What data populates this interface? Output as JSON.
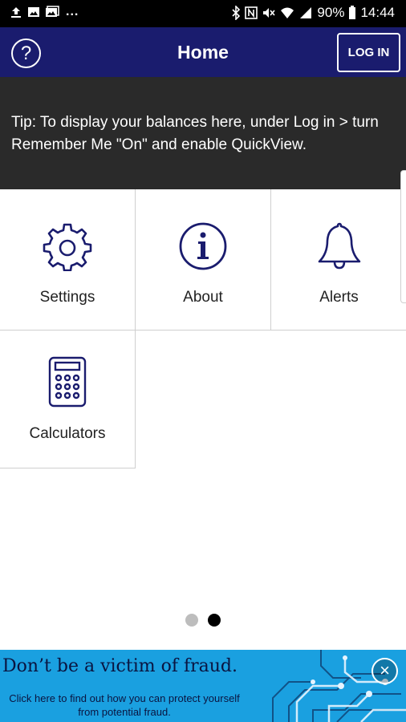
{
  "status_bar": {
    "battery_percent": "90%",
    "time": "14:44",
    "overflow": "...",
    "left_icons": [
      "upload-icon",
      "image-icon",
      "gallery-icon"
    ],
    "right_icons": [
      "bluetooth-icon",
      "nfc-icon",
      "mute-icon",
      "wifi-icon",
      "signal-icon",
      "battery-icon"
    ]
  },
  "app_bar": {
    "title": "Home",
    "help_symbol": "?",
    "login_label": "LOG IN",
    "background": "#1a1c6e"
  },
  "tip": {
    "text": "Tip: To display your balances here, under Log in > turn Remember Me \"On\" and enable QuickView."
  },
  "tiles": [
    {
      "label": "Settings",
      "icon": "gear-icon"
    },
    {
      "label": "About",
      "icon": "info-icon"
    },
    {
      "label": "Alerts",
      "icon": "bell-icon"
    },
    {
      "label": "Calculators",
      "icon": "calculator-icon"
    }
  ],
  "pager": {
    "total": 2,
    "active_index": 1
  },
  "banner": {
    "headline": "Don’t be a victim of fraud.",
    "subtext": "Click here to find out how you can protect yourself from potential fraud.",
    "close_symbol": "×",
    "background": "#1aa0e0"
  }
}
